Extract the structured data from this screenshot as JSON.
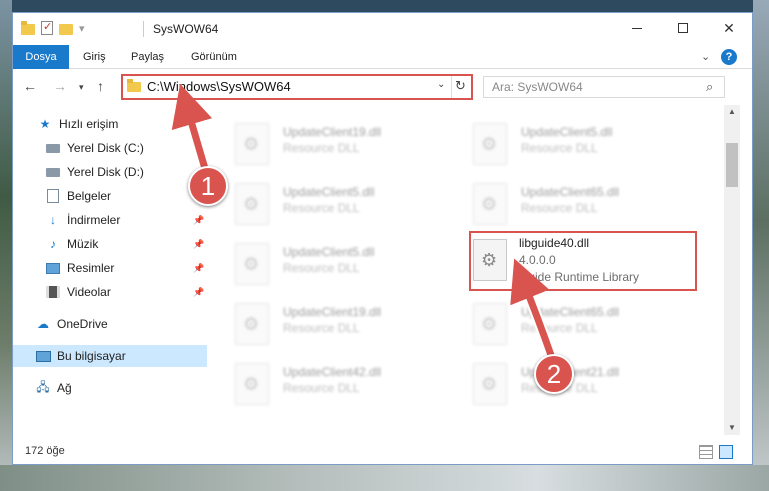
{
  "window": {
    "title": "SysWOW64",
    "minimize_glyph": "—",
    "close_glyph": "✕"
  },
  "ribbon": {
    "tabs": [
      {
        "label": "Dosya"
      },
      {
        "label": "Giriş"
      },
      {
        "label": "Paylaş"
      },
      {
        "label": "Görünüm"
      }
    ],
    "help_glyph": "?"
  },
  "nav": {
    "address": "C:\\Windows\\SysWOW64",
    "search_placeholder": "Ara: SysWOW64"
  },
  "sidebar": {
    "items": [
      {
        "label": "Hızlı erişim",
        "icon": "star-icon"
      },
      {
        "label": "Yerel Disk (C:)",
        "icon": "drive-icon"
      },
      {
        "label": "Yerel Disk (D:)",
        "icon": "drive-icon"
      },
      {
        "label": "Belgeler",
        "icon": "documents-icon"
      },
      {
        "label": "İndirmeler",
        "icon": "download-icon"
      },
      {
        "label": "Müzik",
        "icon": "music-icon"
      },
      {
        "label": "Resimler",
        "icon": "pictures-icon"
      },
      {
        "label": "Videolar",
        "icon": "videos-icon"
      },
      {
        "label": "OneDrive",
        "icon": "cloud-icon"
      },
      {
        "label": "Bu bilgisayar",
        "icon": "computer-icon"
      },
      {
        "label": "Ağ",
        "icon": "network-icon"
      }
    ]
  },
  "files": [
    {
      "name": "UpdateClient19.dll",
      "desc": "Resource DLL"
    },
    {
      "name": "UpdateClient5.dll",
      "desc": "Resource DLL"
    },
    {
      "name": "UpdateClient5.dll",
      "desc": "Resource DLL"
    },
    {
      "name": "UpdateClient65.dll",
      "desc": "Resource DLL"
    },
    {
      "name": "UpdateClient5.dll",
      "desc": "Resource DLL"
    },
    {
      "name": "libguide40.dll",
      "desc": "4.0.0.0",
      "desc2": "Guide Runtime Library"
    },
    {
      "name": "UpdateClient19.dll",
      "desc": "Resource DLL"
    },
    {
      "name": "UpdateClient65.dll",
      "desc": "Resource DLL"
    },
    {
      "name": "UpdateClient42.dll",
      "desc": "Resource DLL"
    },
    {
      "name": "UpdateClient21.dll",
      "desc": "Resource DLL"
    }
  ],
  "status": {
    "count": "172 öğe"
  },
  "annotations": {
    "step1": "1",
    "step2": "2",
    "color": "#d9534f"
  },
  "colors": {
    "accent": "#1979ca",
    "highlight": "#d9534f",
    "selected": "#cce8ff"
  }
}
